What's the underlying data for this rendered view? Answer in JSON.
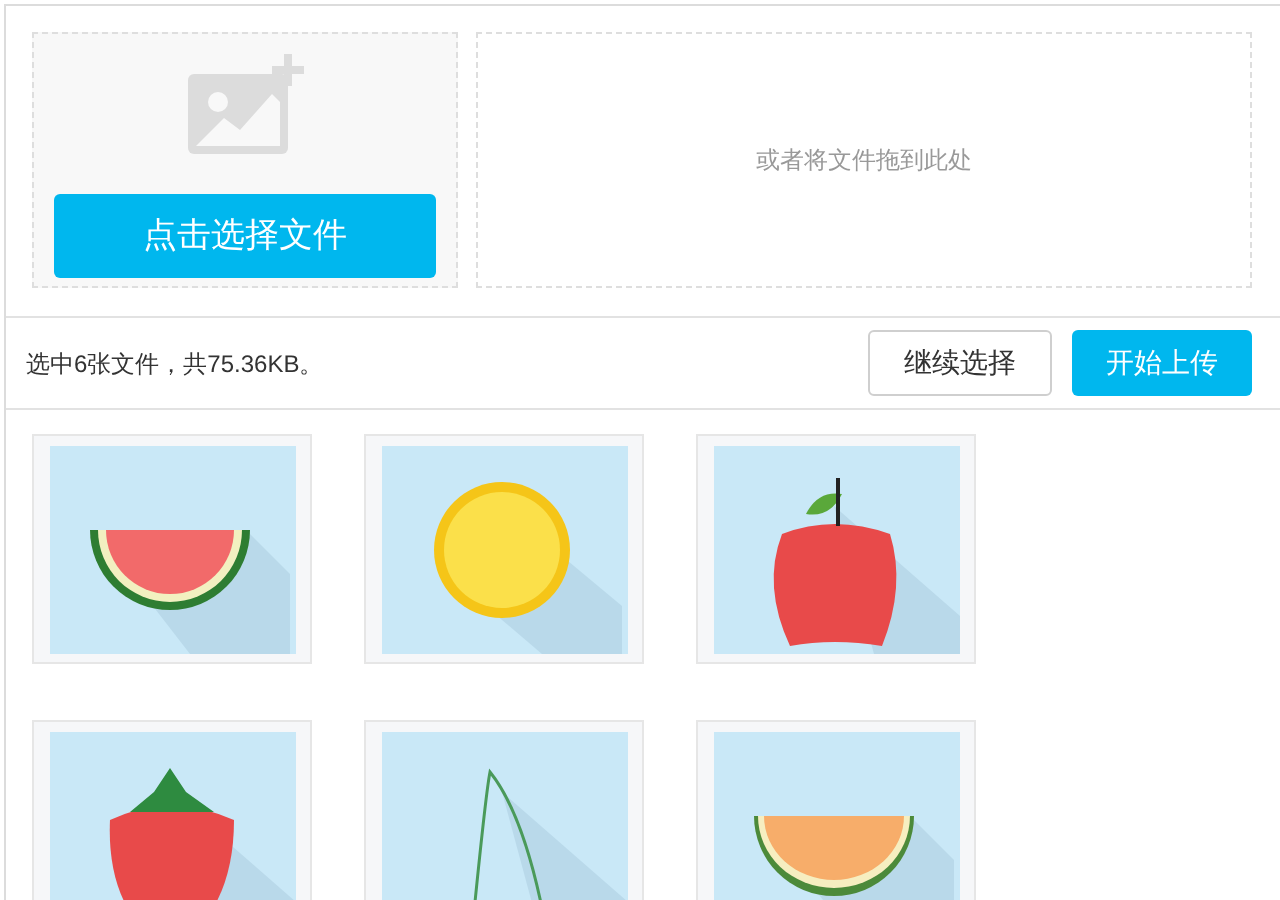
{
  "picker": {
    "button": "点击选择文件"
  },
  "drop_zone": {
    "hint": "或者将文件拖到此处"
  },
  "status": {
    "summary": "选中6张文件，共75.36KB。"
  },
  "buttons": [
    {
      "label": "继续选择",
      "kind": "secondary"
    },
    {
      "label": "开始上传",
      "kind": "primary"
    }
  ]
}
